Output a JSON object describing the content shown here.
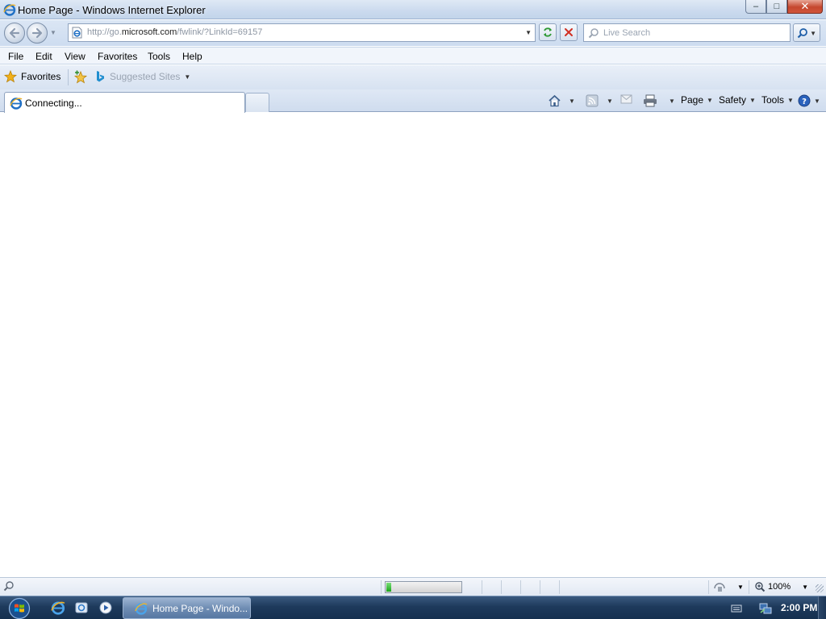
{
  "window": {
    "title": "Home Page - Windows Internet Explorer",
    "minimize_glyph": "–",
    "maximize_glyph": "□",
    "close_glyph": "✕"
  },
  "address_bar": {
    "url_prefix": "http://go.",
    "url_domain": "microsoft.com",
    "url_suffix": "/fwlink/?LinkId=69157"
  },
  "search": {
    "placeholder": "Live Search"
  },
  "menu": {
    "file": "File",
    "edit": "Edit",
    "view": "View",
    "favorites": "Favorites",
    "tools": "Tools",
    "help": "Help"
  },
  "favorites_bar": {
    "favorites_label": "Favorites",
    "suggested_sites_label": "Suggested Sites"
  },
  "tabs": {
    "active_label": "Connecting..."
  },
  "command_bar": {
    "page_label": "Page",
    "safety_label": "Safety",
    "tools_label": "Tools"
  },
  "status_bar": {
    "zoom_level": "100%",
    "progress_fraction": 0.07
  },
  "taskbar": {
    "task_label": "Home Page - Windo...",
    "clock": "2:00 PM"
  },
  "colors": {
    "ie_blue": "#1f6fc4",
    "favorites_star": "#f2b019",
    "progress_green": "#1aa51a"
  },
  "icons": [
    "ie-icon",
    "back-arrow-icon",
    "forward-arrow-icon",
    "page-icon",
    "refresh-icon",
    "stop-icon",
    "search-icon",
    "star-icon",
    "add-favorites-icon",
    "bing-icon",
    "home-icon",
    "feeds-icon",
    "mail-icon",
    "print-icon",
    "help-icon",
    "magnifier-icon",
    "protected-mode-icon",
    "zoom-icon",
    "windows-start-icon",
    "show-desktop-icon",
    "media-player-icon",
    "network-icon"
  ]
}
